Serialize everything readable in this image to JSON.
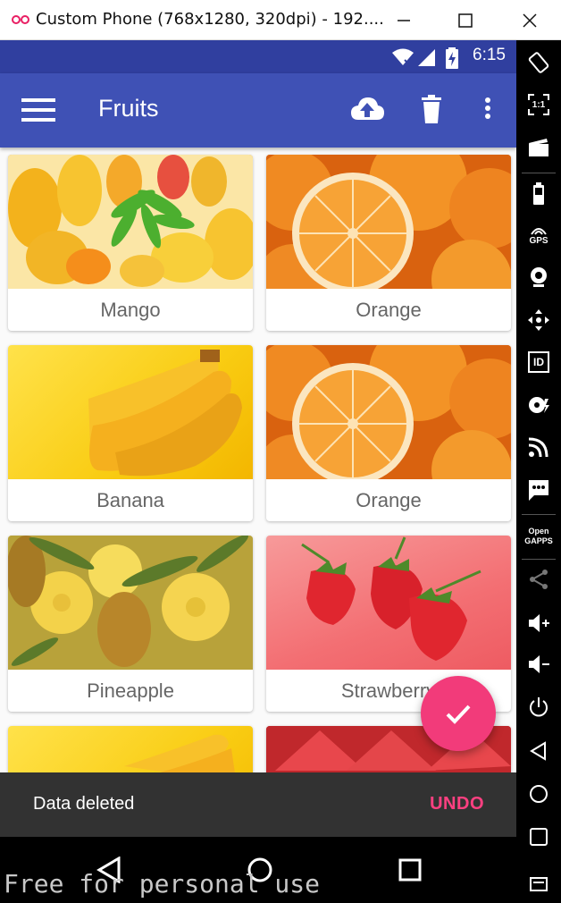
{
  "window": {
    "title": "Custom Phone (768x1280, 320dpi) - 192....",
    "minimize_icon": "minimize-icon",
    "maximize_icon": "maximize-icon",
    "close_icon": "close-icon"
  },
  "status_bar": {
    "time": "6:15",
    "icons": [
      "wifi-icon",
      "signal-icon",
      "battery-charging-icon"
    ],
    "color": "#303f9f"
  },
  "app_bar": {
    "title": "Fruits",
    "color": "#3f51b5",
    "actions": [
      "upload-icon",
      "delete-icon",
      "more-options-icon"
    ]
  },
  "fruits": [
    {
      "name": "Mango"
    },
    {
      "name": "Orange"
    },
    {
      "name": "Banana"
    },
    {
      "name": "Orange"
    },
    {
      "name": "Pineapple"
    },
    {
      "name": "Strawberry"
    }
  ],
  "fab": {
    "icon": "check-icon",
    "color": "#f23b7a"
  },
  "snackbar": {
    "message": "Data deleted",
    "action": "UNDO",
    "action_color": "#ff4081"
  },
  "nav_bar": {
    "icons": [
      "back-icon",
      "home-icon",
      "recents-icon"
    ]
  },
  "watermark": "Free for personal use",
  "emulator_toolbar": {
    "buttons": [
      "rotate-icon",
      "pixel-perfect-icon",
      "screencast-icon",
      "battery-icon",
      "gps-icon",
      "camera-icon",
      "move-icon",
      "identifiers-icon",
      "disk-icon",
      "remote-control-icon",
      "sms-icon",
      "open-gapps-icon",
      "share-icon",
      "volume-up-icon",
      "volume-down-icon",
      "power-icon",
      "back-icon",
      "home-icon",
      "recents-icon",
      "menu-icon"
    ],
    "gps_label": "GPS",
    "id_label": "ID",
    "pixel_label": "1:1",
    "gapps_label": "Open GAPPS"
  }
}
